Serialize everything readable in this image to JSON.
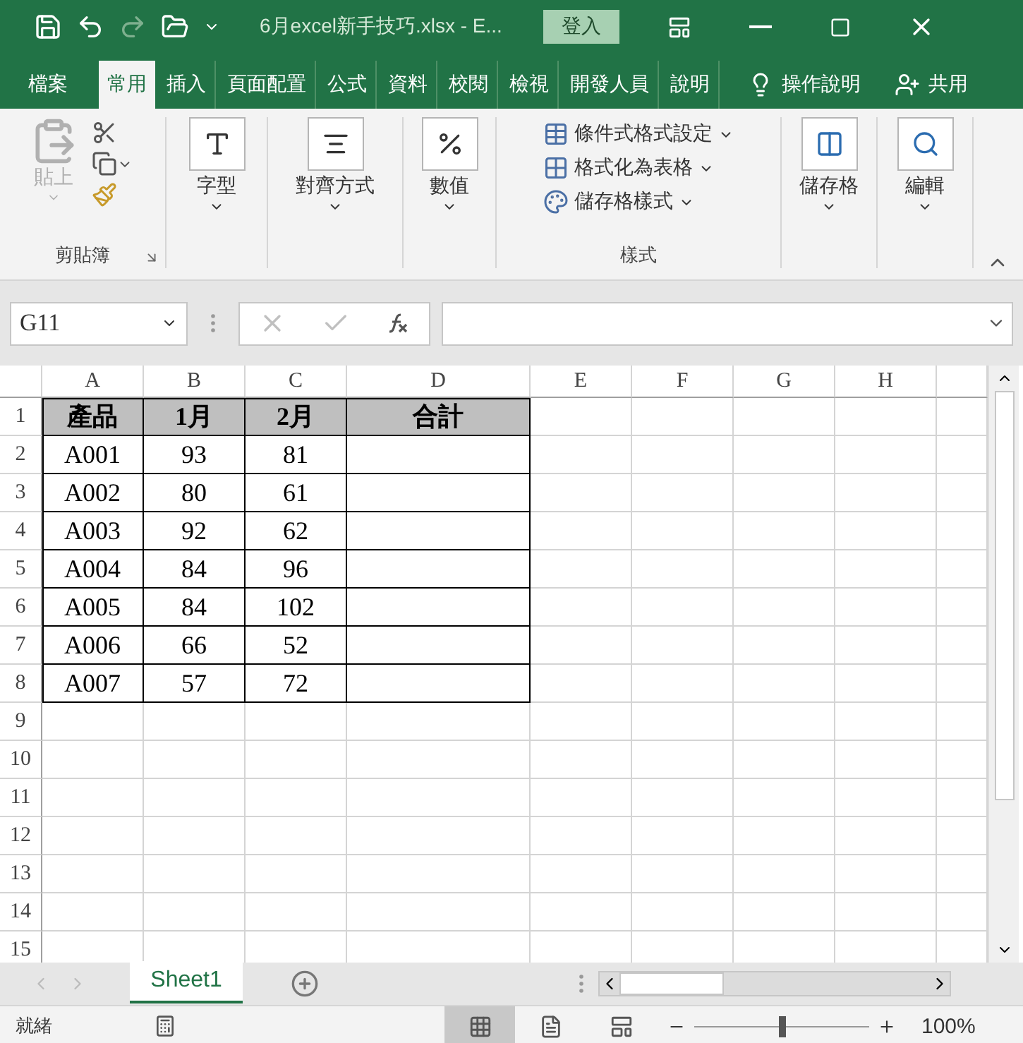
{
  "title_bar": {
    "quick_access": [
      {
        "kind": "save",
        "disabled": false
      },
      {
        "kind": "undo",
        "disabled": false
      },
      {
        "kind": "redo",
        "disabled": true
      },
      {
        "kind": "open",
        "disabled": false
      },
      {
        "kind": "customize",
        "disabled": false
      }
    ],
    "title": "6月excel新手技巧.xlsx  -  E...",
    "sign_in": "登入"
  },
  "menu_tabs": [
    {
      "label": "檔案",
      "selected": false
    },
    {
      "label": "常用",
      "selected": true
    },
    {
      "label": "插入",
      "selected": false
    },
    {
      "label": "頁面配置",
      "selected": false
    },
    {
      "label": "公式",
      "selected": false
    },
    {
      "label": "資料",
      "selected": false
    },
    {
      "label": "校閱",
      "selected": false
    },
    {
      "label": "檢視",
      "selected": false
    },
    {
      "label": "開發人員",
      "selected": false
    },
    {
      "label": "說明",
      "selected": false
    }
  ],
  "tell_me": "操作說明",
  "share": "共用",
  "ribbon": {
    "clipboard": {
      "paste": "貼上",
      "paste_disabled": true,
      "label": "剪貼簿"
    },
    "big_groups": [
      {
        "kind": "font",
        "label": "字型"
      },
      {
        "kind": "alignment",
        "label": "對齊方式"
      },
      {
        "kind": "number",
        "label": "數值"
      }
    ],
    "styles": {
      "items": [
        {
          "kind": "conditional",
          "label": "條件式格式設定"
        },
        {
          "kind": "table",
          "label": "格式化為表格"
        },
        {
          "kind": "cell",
          "label": "儲存格樣式"
        }
      ],
      "label": "樣式"
    },
    "end_groups": [
      {
        "kind": "cells",
        "label": "儲存格"
      },
      {
        "kind": "editing",
        "label": "編輯"
      }
    ]
  },
  "formula_bar": {
    "name_box": "G11",
    "buttons": [
      {
        "kind": "cancel",
        "disabled": true
      },
      {
        "kind": "enter",
        "disabled": true
      },
      {
        "kind": "function",
        "disabled": false
      }
    ]
  },
  "sheet": {
    "columns": [
      "A",
      "B",
      "C",
      "D",
      "E",
      "F",
      "G",
      "H"
    ],
    "rows": [
      {
        "number": "1",
        "kind": "header",
        "cells": [
          "產品",
          "1月",
          "2月",
          "合計"
        ]
      },
      {
        "number": "2",
        "kind": "data",
        "cells": [
          "A001",
          "93",
          "81"
        ]
      },
      {
        "number": "3",
        "kind": "data",
        "cells": [
          "A002",
          "80",
          "61"
        ]
      },
      {
        "number": "4",
        "kind": "data",
        "cells": [
          "A003",
          "92",
          "62"
        ]
      },
      {
        "number": "5",
        "kind": "data",
        "cells": [
          "A004",
          "84",
          "96"
        ]
      },
      {
        "number": "6",
        "kind": "data",
        "cells": [
          "A005",
          "84",
          "102"
        ]
      },
      {
        "number": "7",
        "kind": "data",
        "cells": [
          "A006",
          "66",
          "52"
        ]
      },
      {
        "number": "8",
        "kind": "data",
        "cells": [
          "A007",
          "57",
          "72"
        ]
      },
      {
        "number": "9",
        "kind": "empty"
      },
      {
        "number": "10",
        "kind": "empty"
      },
      {
        "number": "11",
        "kind": "empty"
      },
      {
        "number": "12",
        "kind": "empty"
      },
      {
        "number": "13",
        "kind": "empty"
      },
      {
        "number": "14",
        "kind": "empty"
      },
      {
        "number": "15",
        "kind": "empty"
      }
    ]
  },
  "sheet_tabs": [
    {
      "label": "Sheet1",
      "selected": true
    }
  ],
  "status_bar": {
    "status": "就緒",
    "views": [
      {
        "kind": "normal",
        "selected": true
      },
      {
        "kind": "page_layout",
        "selected": false
      },
      {
        "kind": "page_break",
        "selected": false
      }
    ],
    "zoom": {
      "level": 0.5,
      "reading": "100%"
    }
  }
}
